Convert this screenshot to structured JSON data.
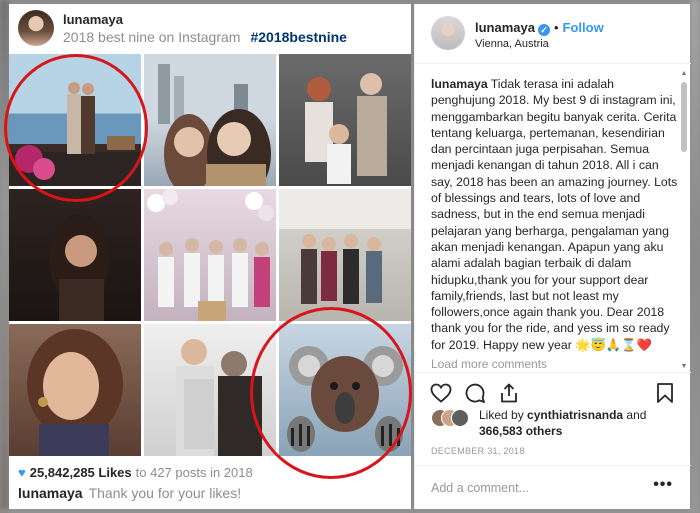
{
  "post": {
    "username": "lunamaya",
    "subtitle": "2018 best nine on Instagram",
    "hashtag": "#2018bestnine",
    "likes_count": "25,842,285 Likes",
    "likes_suffix": "to 427 posts in 2018",
    "thanks_user": "lunamaya",
    "thanks_text": "Thank you for your likes!"
  },
  "sidebar": {
    "username": "lunamaya",
    "follow_label": "Follow",
    "location": "Vienna, Austria",
    "caption_user": "lunamaya",
    "caption_text": "Tidak terasa ini adalah penghujung 2018. My best 9 di instagram ini, menggambarkan begitu banyak cerita. Cerita tentang keluarga, pertemanan, kesendirian dan percintaan juga perpisahan. Semua menjadi kenangan di tahun 2018. All i can say, 2018 has been an amazing journey. Lots of blessings and tears, lots of love and sadness, but in the end semua menjadi pelajaran yang berharga, pengalaman yang akan menjadi kenangan. Apapun yang aku alami adalah bagian terbaik di dalam hidupku,thank you for your support dear family,friends, last but not least my followers,once again thank you. Dear 2018 thank you for the ride, and yess im so ready for 2019. Happy new year 🌟😇🙏⌛❤️",
    "load_more": "Load more comments",
    "liked_by_prefix": "Liked by",
    "liked_by_user": "cynthiatrisnanda",
    "liked_by_and": "and",
    "liked_by_others": "366,583 others",
    "date": "DECEMBER 31, 2018",
    "comment_placeholder": "Add a comment...",
    "more_icon": "•••"
  },
  "icons": {
    "heart": "heart-icon",
    "comment": "comment-icon",
    "share": "share-icon",
    "bookmark": "bookmark-icon",
    "verified": "verified-badge-icon"
  },
  "colors": {
    "link_blue": "#3897f0",
    "annotation_red": "#d7151a",
    "hashtag_navy": "#003569"
  }
}
